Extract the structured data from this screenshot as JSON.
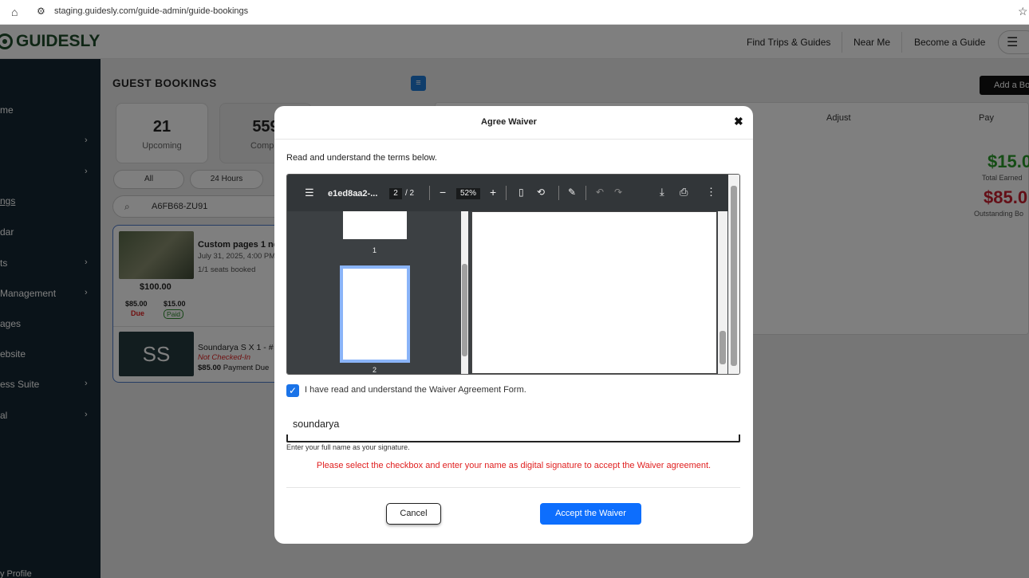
{
  "browser": {
    "url": "staging.guidesly.com/guide-admin/guide-bookings"
  },
  "header": {
    "logo": "GUIDESLY",
    "nav": [
      "Find Trips & Guides",
      "Near Me",
      "Become a Guide"
    ]
  },
  "sidebar": {
    "items": [
      {
        "label": "me",
        "chevron": false
      },
      {
        "label": "",
        "chevron": true
      },
      {
        "label": "",
        "chevron": true
      },
      {
        "label": "ngs",
        "chevron": false
      },
      {
        "label": "dar",
        "chevron": false
      },
      {
        "label": "ts",
        "chevron": true
      },
      {
        "label": "Management",
        "chevron": true
      },
      {
        "label": "ages",
        "chevron": false
      },
      {
        "label": "ebsite",
        "chevron": false
      },
      {
        "label": "ess Suite",
        "chevron": true
      },
      {
        "label": "al",
        "chevron": true
      }
    ],
    "bottom": "y Profile"
  },
  "bookings": {
    "title": "GUEST BOOKINGS",
    "add_label": "Add a Bo",
    "stats": [
      {
        "value": "21",
        "label": "Upcoming"
      },
      {
        "value": "559",
        "label": "Comple"
      }
    ],
    "filters": [
      "All",
      "24 Hours"
    ],
    "search_value": "A6FB68-ZU91",
    "card1": {
      "title": "Custom pages 1 nev",
      "date": "July 31, 2025, 4:00 PM",
      "seats": "1/1 seats booked",
      "price": "$100.00",
      "due_amount": "$85.00",
      "due_label": "Due",
      "paid_amount": "$15.00",
      "paid_label": "Paid"
    },
    "card2": {
      "initials": "SS",
      "title": "Soundarya S X 1 - #",
      "status": "Not Checked-In",
      "payment_amount": "$85.00",
      "payment_label": "Payment Due"
    },
    "columns": [
      "Adjust",
      "Pay"
    ],
    "earned": {
      "amount": "$15.0",
      "label": "Total Earned"
    },
    "outstanding": {
      "amount": "$85.0",
      "label": "Outstanding Bo"
    }
  },
  "modal": {
    "title": "Agree Waiver",
    "close": "✖",
    "intro": "Read and understand the terms below.",
    "pdf": {
      "filename": "e1ed8aa2-...",
      "page": "2",
      "pages": "/ 2",
      "zoom": "52%",
      "thumb_labels": [
        "1",
        "2"
      ]
    },
    "checkbox_label": "I have read and understand the Waiver Agreement Form.",
    "signature_value": "soundarya",
    "signature_help": "Enter your full name as your signature.",
    "error": "Please select the checkbox and enter your name as digital signature to accept the Waiver agreement.",
    "cancel_label": "Cancel",
    "accept_label": "Accept the Waiver"
  }
}
